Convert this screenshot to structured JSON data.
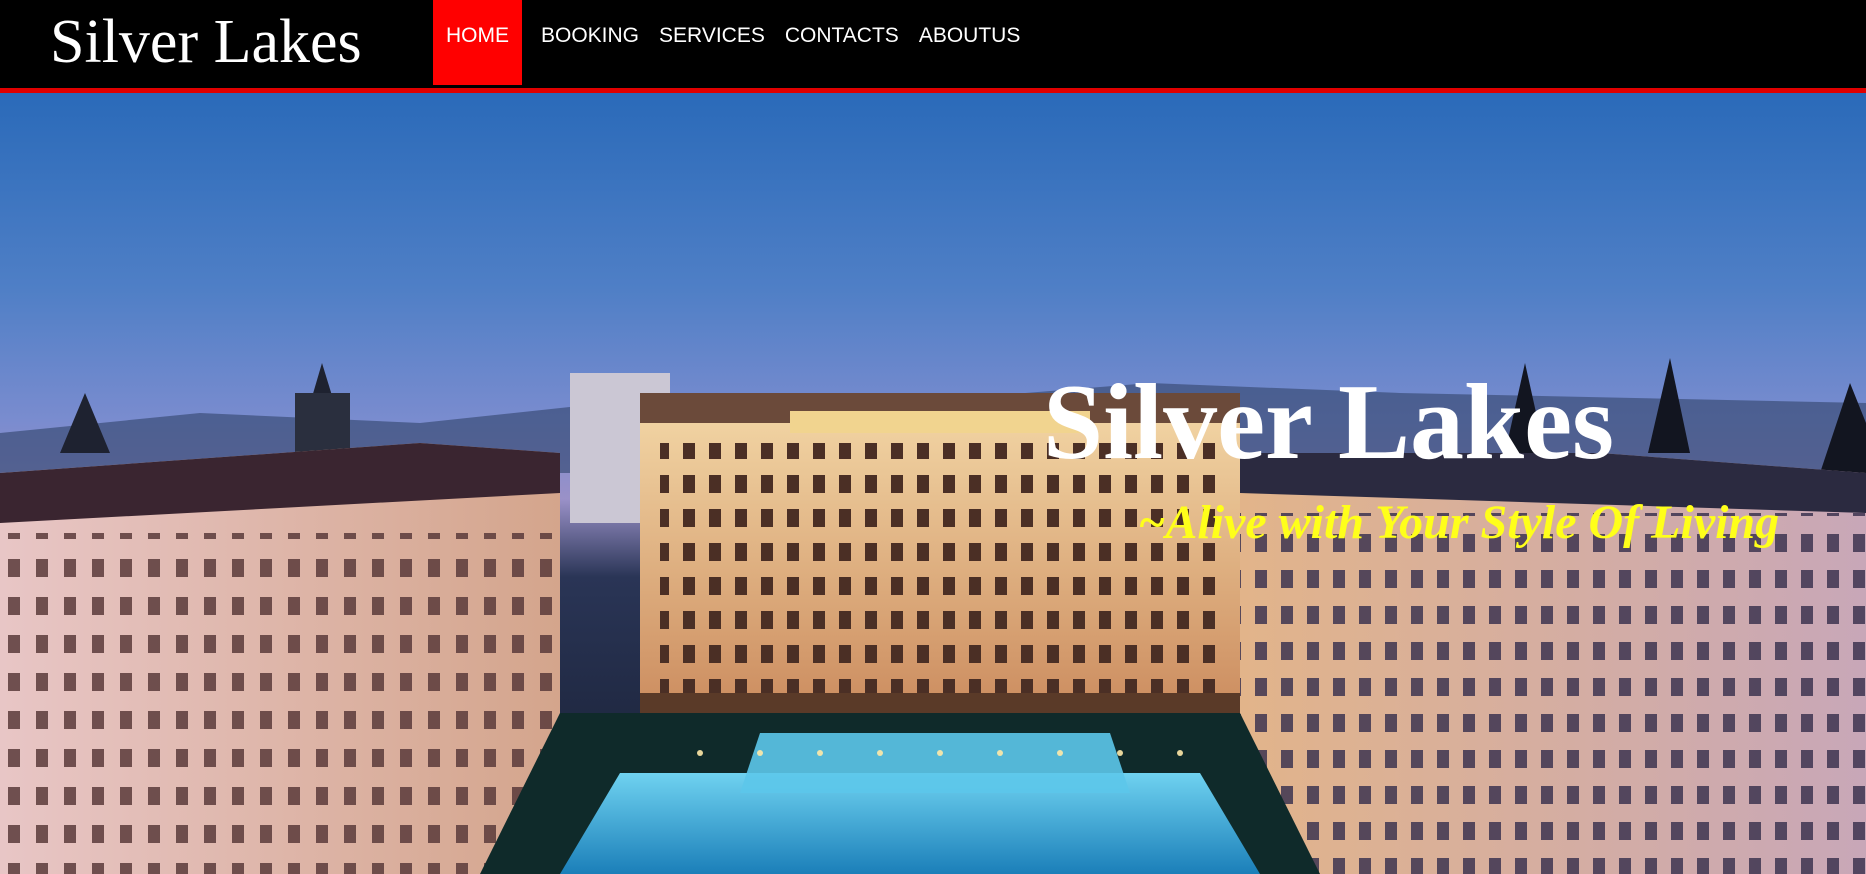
{
  "site": {
    "brand": "Silver Lakes"
  },
  "nav": {
    "items": [
      {
        "label": "HOME",
        "active": true
      },
      {
        "label": "BOOKING",
        "active": false
      },
      {
        "label": "SERVICES",
        "active": false
      },
      {
        "label": "CONTACTS",
        "active": false
      },
      {
        "label": "ABOUTUS",
        "active": false
      }
    ]
  },
  "hero": {
    "title": "Silver Lakes",
    "tagline": "~Alive with Your Style Of Living",
    "image": "resort-night-photo"
  },
  "colors": {
    "accent": "#ff0000",
    "tagline": "#ffff1a",
    "header_bg": "#000000"
  }
}
